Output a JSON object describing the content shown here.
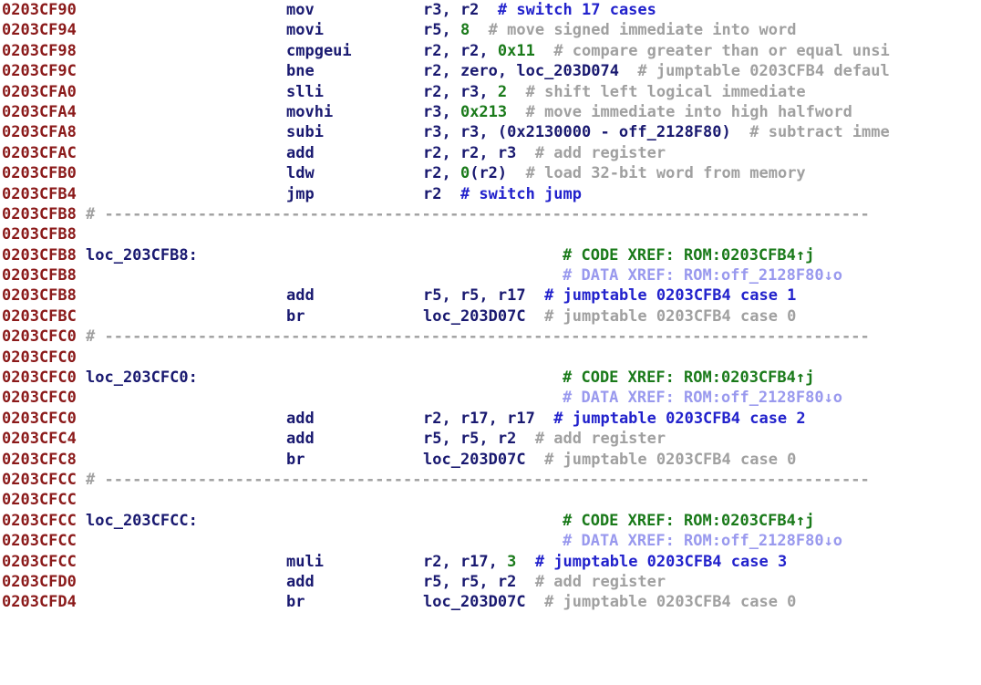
{
  "view": {
    "name": "ida-disassembly-listing",
    "segment": "ROM",
    "architecture": "Nios II",
    "colors": {
      "background": "#ffffff",
      "address": "#8b1a1a",
      "mnemonic": "#191970",
      "operand": "#191970",
      "immediate": "#1a7a1a",
      "comment": "#a0a0a0",
      "repeatable_comment": "#2222cc",
      "code_xref": "#1a7a1a",
      "data_xref": "#9999ee",
      "separator": "#a0a0a0"
    },
    "separator_text": "# ----------------------------------------------------------------------------------"
  },
  "lines": [
    {
      "kind": "insn",
      "address": "0203CF90",
      "mnemonic": "mov",
      "operands": [
        {
          "text": "r3, r2",
          "cls": "reg"
        }
      ],
      "comment": "# switch 17 cases",
      "comment_style": "repeatable"
    },
    {
      "kind": "insn",
      "address": "0203CF94",
      "mnemonic": "movi",
      "operands": [
        {
          "text": "r5, ",
          "cls": "reg"
        },
        {
          "text": "8",
          "cls": "num"
        }
      ],
      "comment": "# move signed immediate into word",
      "comment_style": "regular"
    },
    {
      "kind": "insn",
      "address": "0203CF98",
      "mnemonic": "cmpgeui",
      "operands": [
        {
          "text": "r2, r2, ",
          "cls": "reg"
        },
        {
          "text": "0x11",
          "cls": "num"
        }
      ],
      "comment": "# compare greater than or equal unsi",
      "comment_style": "regular"
    },
    {
      "kind": "insn",
      "address": "0203CF9C",
      "mnemonic": "bne",
      "operands": [
        {
          "text": "r2, zero, ",
          "cls": "reg"
        },
        {
          "text": "loc_203D074",
          "cls": "loc"
        }
      ],
      "comment": "# jumptable 0203CFB4 defaul",
      "comment_style": "regular"
    },
    {
      "kind": "insn",
      "address": "0203CFA0",
      "mnemonic": "slli",
      "operands": [
        {
          "text": "r2, r3, ",
          "cls": "reg"
        },
        {
          "text": "2",
          "cls": "num"
        }
      ],
      "comment": "# shift left logical immediate",
      "comment_style": "regular"
    },
    {
      "kind": "insn",
      "address": "0203CFA4",
      "mnemonic": "movhi",
      "operands": [
        {
          "text": "r3, ",
          "cls": "reg"
        },
        {
          "text": "0x213",
          "cls": "num"
        }
      ],
      "comment": "# move immediate into high halfword",
      "comment_style": "regular"
    },
    {
      "kind": "insn",
      "address": "0203CFA8",
      "mnemonic": "subi",
      "operands": [
        {
          "text": "r3, r3, (0x2130000 - off_2128F80)",
          "cls": "reg"
        }
      ],
      "comment": "# subtract imme",
      "comment_style": "regular"
    },
    {
      "kind": "insn",
      "address": "0203CFAC",
      "mnemonic": "add",
      "operands": [
        {
          "text": "r2, r2, r3",
          "cls": "reg"
        }
      ],
      "comment": "# add register",
      "comment_style": "regular"
    },
    {
      "kind": "insn",
      "address": "0203CFB0",
      "mnemonic": "ldw",
      "operands": [
        {
          "text": "r2, ",
          "cls": "reg"
        },
        {
          "text": "0",
          "cls": "num"
        },
        {
          "text": "(r2)",
          "cls": "reg"
        }
      ],
      "comment": "# load 32-bit word from memory",
      "comment_style": "regular"
    },
    {
      "kind": "insn",
      "address": "0203CFB4",
      "mnemonic": "jmp",
      "operands": [
        {
          "text": "r2",
          "cls": "reg"
        }
      ],
      "comment": "# switch jump",
      "comment_style": "repeatable"
    },
    {
      "kind": "separator",
      "address": "0203CFB8"
    },
    {
      "kind": "blank",
      "address": "0203CFB8"
    },
    {
      "kind": "label",
      "address": "0203CFB8",
      "label": "loc_203CFB8:",
      "xref": "# CODE XREF: ROM:0203CFB4↑j",
      "xref_style": "code"
    },
    {
      "kind": "xref",
      "address": "0203CFB8",
      "xref": "# DATA XREF: ROM:off_2128F80↓o",
      "xref_style": "data"
    },
    {
      "kind": "insn",
      "address": "0203CFB8",
      "mnemonic": "add",
      "operands": [
        {
          "text": "r5, r5, r17",
          "cls": "reg"
        }
      ],
      "comment": "# jumptable 0203CFB4 case 1",
      "comment_style": "repeatable"
    },
    {
      "kind": "insn",
      "address": "0203CFBC",
      "mnemonic": "br",
      "operands": [
        {
          "text": "loc_203D07C",
          "cls": "loc"
        }
      ],
      "comment": "# jumptable 0203CFB4 case 0",
      "comment_style": "regular"
    },
    {
      "kind": "separator",
      "address": "0203CFC0"
    },
    {
      "kind": "blank",
      "address": "0203CFC0"
    },
    {
      "kind": "label",
      "address": "0203CFC0",
      "label": "loc_203CFC0:",
      "xref": "# CODE XREF: ROM:0203CFB4↑j",
      "xref_style": "code"
    },
    {
      "kind": "xref",
      "address": "0203CFC0",
      "xref": "# DATA XREF: ROM:off_2128F80↓o",
      "xref_style": "data"
    },
    {
      "kind": "insn",
      "address": "0203CFC0",
      "mnemonic": "add",
      "operands": [
        {
          "text": "r2, r17, r17",
          "cls": "reg"
        }
      ],
      "comment": "# jumptable 0203CFB4 case 2",
      "comment_style": "repeatable"
    },
    {
      "kind": "insn",
      "address": "0203CFC4",
      "mnemonic": "add",
      "operands": [
        {
          "text": "r5, r5, r2",
          "cls": "reg"
        }
      ],
      "comment": "# add register",
      "comment_style": "regular"
    },
    {
      "kind": "insn",
      "address": "0203CFC8",
      "mnemonic": "br",
      "operands": [
        {
          "text": "loc_203D07C",
          "cls": "loc"
        }
      ],
      "comment": "# jumptable 0203CFB4 case 0",
      "comment_style": "regular"
    },
    {
      "kind": "separator",
      "address": "0203CFCC"
    },
    {
      "kind": "blank",
      "address": "0203CFCC"
    },
    {
      "kind": "label",
      "address": "0203CFCC",
      "label": "loc_203CFCC:",
      "xref": "# CODE XREF: ROM:0203CFB4↑j",
      "xref_style": "code"
    },
    {
      "kind": "xref",
      "address": "0203CFCC",
      "xref": "# DATA XREF: ROM:off_2128F80↓o",
      "xref_style": "data"
    },
    {
      "kind": "insn",
      "address": "0203CFCC",
      "mnemonic": "muli",
      "operands": [
        {
          "text": "r2, r17, ",
          "cls": "reg"
        },
        {
          "text": "3",
          "cls": "num"
        }
      ],
      "comment": "# jumptable 0203CFB4 case 3",
      "comment_style": "repeatable"
    },
    {
      "kind": "insn",
      "address": "0203CFD0",
      "mnemonic": "add",
      "operands": [
        {
          "text": "r5, r5, r2",
          "cls": "reg"
        }
      ],
      "comment": "# add register",
      "comment_style": "regular"
    },
    {
      "kind": "insn",
      "address": "0203CFD4",
      "mnemonic": "br",
      "operands": [
        {
          "text": "loc_203D07C",
          "cls": "loc"
        }
      ],
      "comment": "# jumptable 0203CFB4 case 0",
      "comment_style": "regular"
    }
  ]
}
